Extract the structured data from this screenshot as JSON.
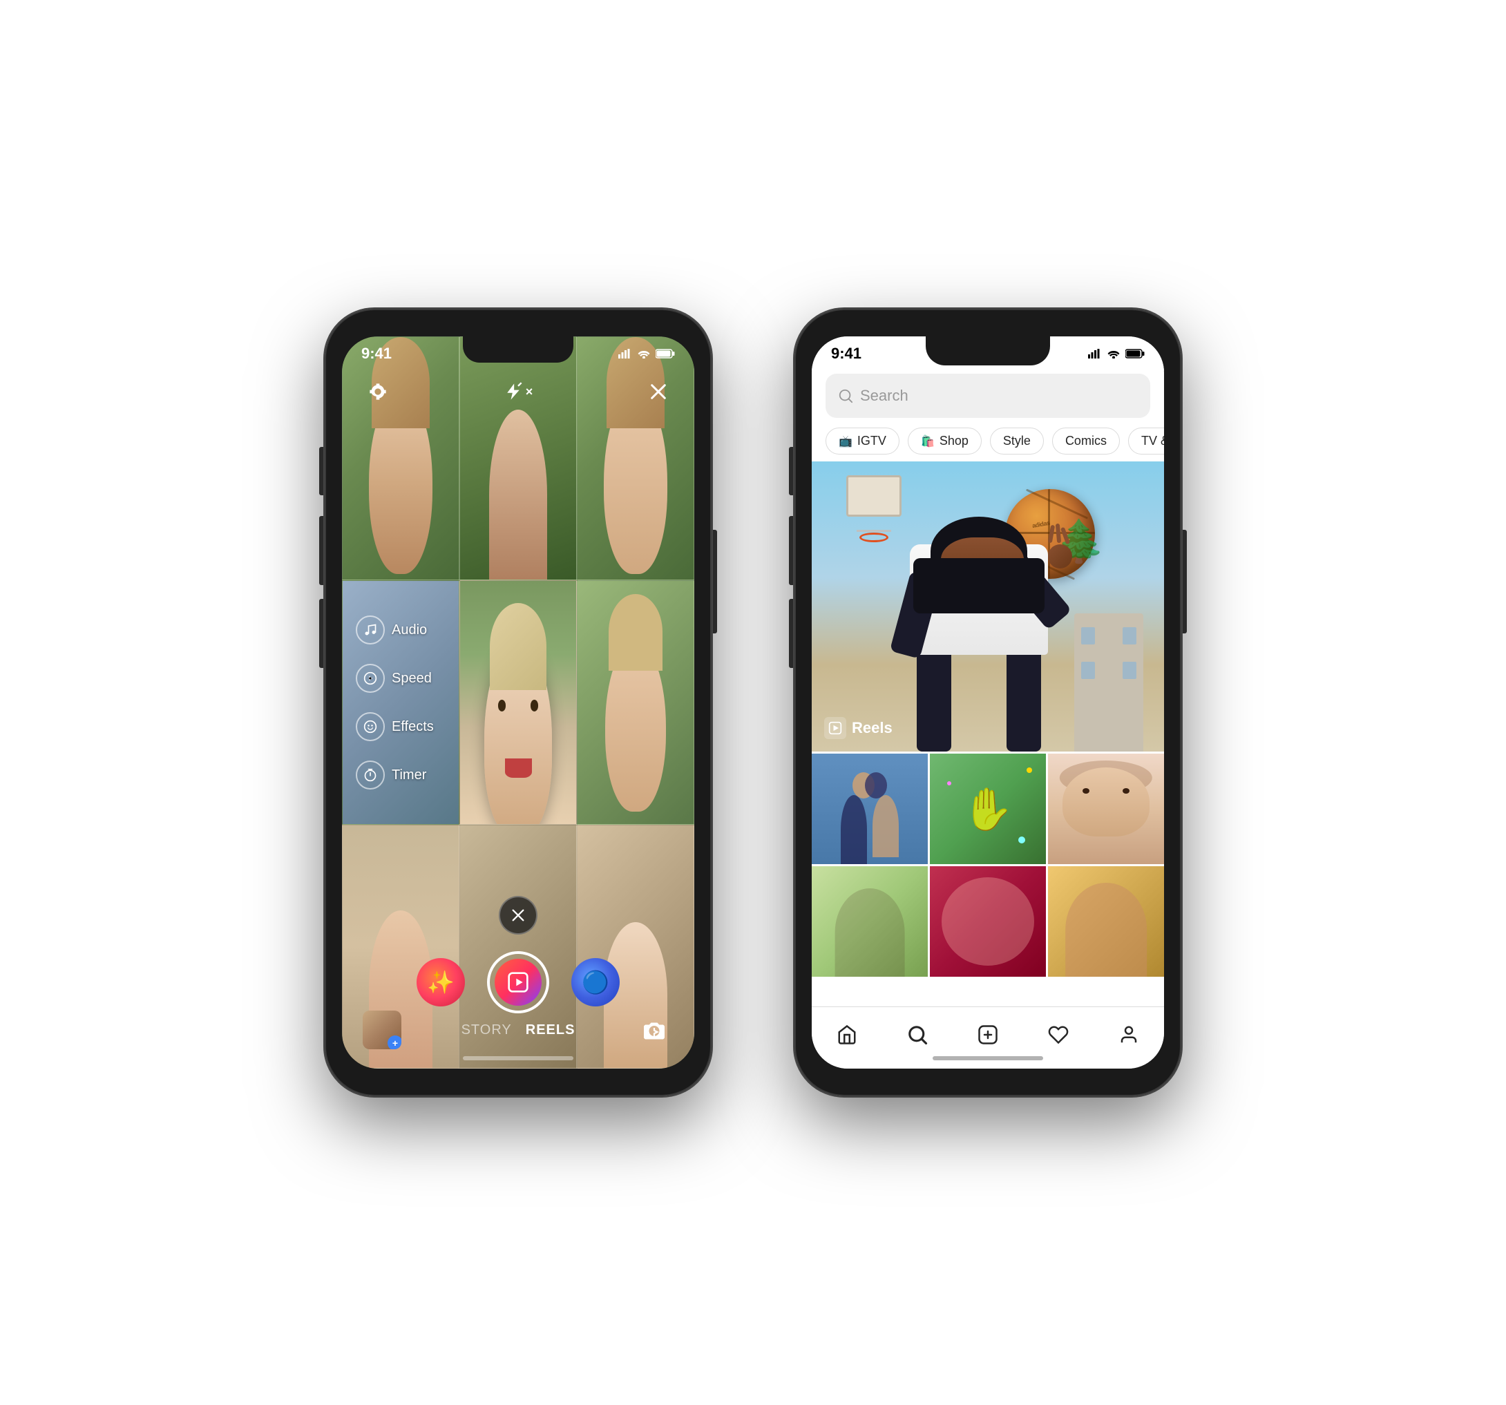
{
  "phone1": {
    "status": {
      "time": "9:41",
      "signal": "signal",
      "wifi": "wifi",
      "battery": "battery"
    },
    "controls": {
      "settings_icon": "settings",
      "flash_icon": "flash-off",
      "close_icon": "close"
    },
    "side_menu": [
      {
        "id": "audio",
        "label": "Audio",
        "icon": "music"
      },
      {
        "id": "speed",
        "label": "Speed",
        "icon": "play-circle"
      },
      {
        "id": "effects",
        "label": "Effects",
        "icon": "smiley"
      },
      {
        "id": "timer",
        "label": "Timer",
        "icon": "clock"
      }
    ],
    "bottom": {
      "cancel_icon": "x",
      "story_label": "STORY",
      "reels_label": "REELS",
      "flip_icon": "flip-camera"
    }
  },
  "phone2": {
    "status": {
      "time": "9:41",
      "signal": "signal",
      "wifi": "wifi",
      "battery": "battery"
    },
    "search": {
      "placeholder": "Search"
    },
    "categories": [
      {
        "id": "igtv",
        "label": "IGTV",
        "icon": "📺"
      },
      {
        "id": "shop",
        "label": "Shop",
        "icon": "🛍️"
      },
      {
        "id": "style",
        "label": "Style",
        "icon": null
      },
      {
        "id": "comics",
        "label": "Comics",
        "icon": null
      },
      {
        "id": "tv-movies",
        "label": "TV & Movies",
        "icon": null
      }
    ],
    "main_content": {
      "reels_label": "Reels"
    },
    "nav": [
      {
        "id": "home",
        "label": "home",
        "icon": "⌂",
        "active": false
      },
      {
        "id": "search",
        "label": "search",
        "icon": "🔍",
        "active": true
      },
      {
        "id": "add",
        "label": "add",
        "icon": "⊕",
        "active": false
      },
      {
        "id": "heart",
        "label": "heart",
        "icon": "♡",
        "active": false
      },
      {
        "id": "profile",
        "label": "profile",
        "icon": "⊙",
        "active": false
      }
    ]
  }
}
